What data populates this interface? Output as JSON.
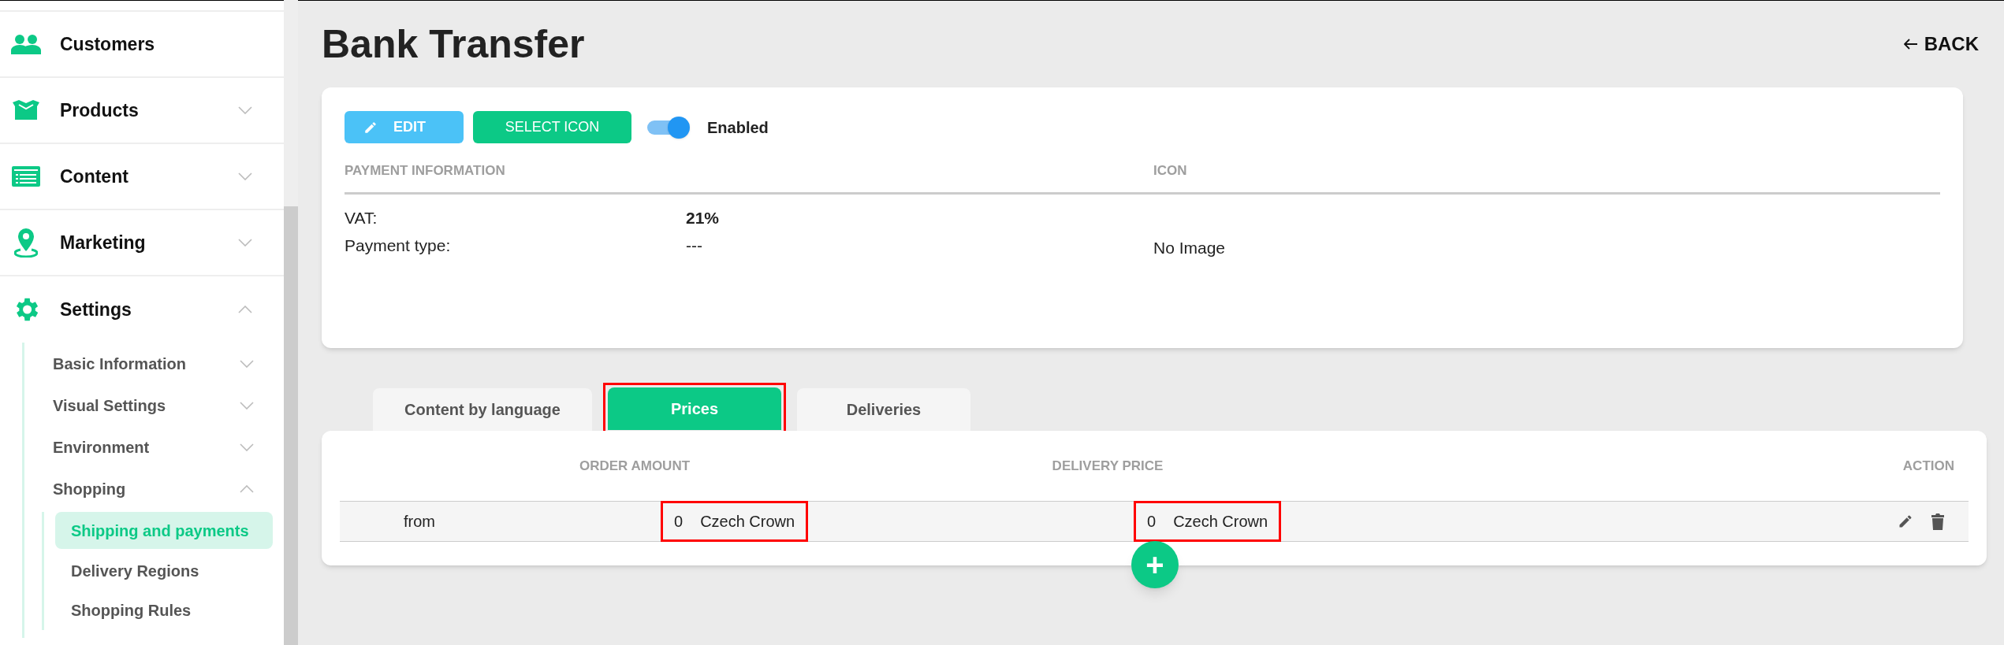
{
  "sidebar": {
    "items": [
      {
        "label": "Customers"
      },
      {
        "label": "Products",
        "expanded": false
      },
      {
        "label": "Content",
        "expanded": false
      },
      {
        "label": "Marketing",
        "expanded": false
      },
      {
        "label": "Settings",
        "expanded": true,
        "children": [
          {
            "label": "Basic Information",
            "expanded": false
          },
          {
            "label": "Visual Settings",
            "expanded": false
          },
          {
            "label": "Environment",
            "expanded": false
          },
          {
            "label": "Shopping",
            "expanded": true,
            "children": [
              {
                "label": "Shipping and payments",
                "selected": true
              },
              {
                "label": "Delivery Regions",
                "selected": false
              },
              {
                "label": "Shopping Rules",
                "selected": false
              }
            ]
          }
        ]
      }
    ]
  },
  "page": {
    "title": "Bank Transfer",
    "back": "BACK"
  },
  "info_card": {
    "edit_button": "EDIT",
    "select_icon_button": "SELECT ICON",
    "toggle": {
      "label": "Enabled",
      "on": true
    },
    "columns": [
      "PAYMENT INFORMATION",
      "ICON"
    ],
    "fields": [
      {
        "label": "VAT:",
        "value": "21%"
      },
      {
        "label": "Payment type:",
        "value": "---"
      }
    ],
    "icon_value": "No Image"
  },
  "tabs": [
    {
      "label": "Content by language",
      "selected": false,
      "highlighted": false
    },
    {
      "label": "Prices",
      "selected": true,
      "highlighted": true
    },
    {
      "label": "Deliveries",
      "selected": false,
      "highlighted": false
    }
  ],
  "prices_table": {
    "columns": [
      "ORDER AMOUNT",
      "DELIVERY PRICE",
      "ACTION"
    ],
    "rows": [
      {
        "label": "from",
        "order_amount": {
          "value": "0",
          "currency": "Czech Crown",
          "highlighted": true
        },
        "delivery_price": {
          "value": "0",
          "currency": "Czech Crown",
          "highlighted": true
        }
      }
    ],
    "add_button": "+"
  }
}
